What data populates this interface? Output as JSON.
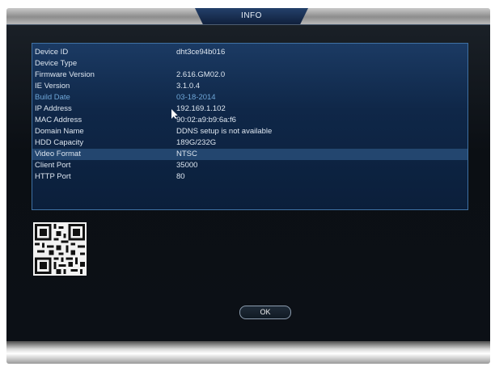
{
  "window": {
    "title": "INFO"
  },
  "info": {
    "rows": [
      {
        "label": "Device ID",
        "value": "dht3ce94b016"
      },
      {
        "label": "Device Type",
        "value": ""
      },
      {
        "label": "Firmware Version",
        "value": "2.616.GM02.0"
      },
      {
        "label": "IE Version",
        "value": "3.1.0.4"
      },
      {
        "label": "Build Date",
        "value": "03-18-2014"
      },
      {
        "label": "IP Address",
        "value": "192.169.1.102"
      },
      {
        "label": "MAC Address",
        "value": "90:02:a9:b9:6a:f6"
      },
      {
        "label": "Domain Name",
        "value": "DDNS setup is not available"
      },
      {
        "label": "HDD Capacity",
        "value": "189G/232G"
      },
      {
        "label": "Video Format",
        "value": "NTSC"
      },
      {
        "label": "Client Port",
        "value": "35000"
      },
      {
        "label": "HTTP Port",
        "value": "80"
      }
    ],
    "highlighted_row": "Video Format",
    "accent_row": "Build Date"
  },
  "buttons": {
    "ok_label": "OK"
  },
  "icons": {
    "qr": "qr-code-icon",
    "cursor": "mouse-pointer-icon"
  },
  "colors": {
    "panel_bg": "#0c1016",
    "info_bg": "#0f2748",
    "info_border": "#3f71a4",
    "highlight": "#23466f",
    "accent_text": "#6fa7d8",
    "title_tab": "#1b3358"
  }
}
